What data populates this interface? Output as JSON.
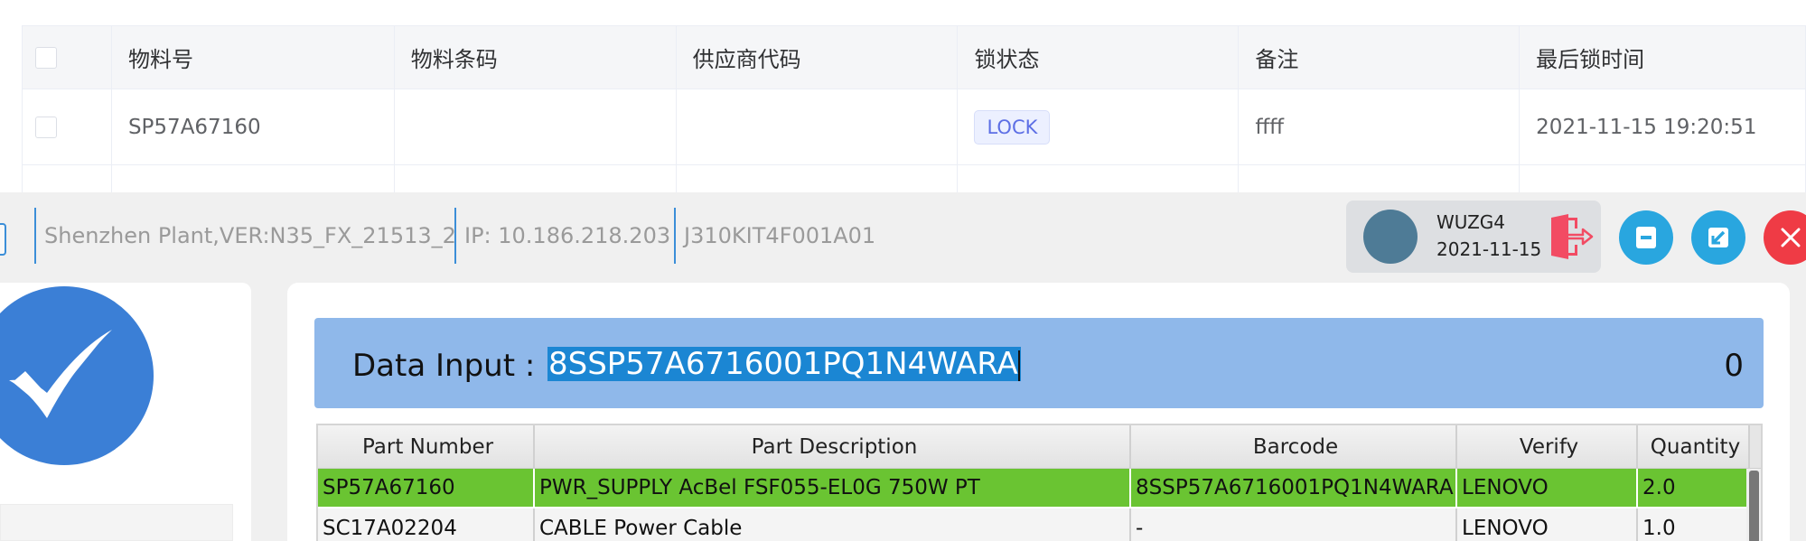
{
  "web_table": {
    "headers": [
      "物料号",
      "物料条码",
      "供应商代码",
      "锁状态",
      "备注",
      "最后锁时间"
    ],
    "rows": [
      {
        "part_no": "SP57A67160",
        "barcode": "",
        "supplier": "",
        "lock_status": "LOCK",
        "remark": "ffff",
        "last_lock_time": "2021-11-15 19:20:51"
      }
    ]
  },
  "status_bar": {
    "plant_version": "Shenzhen Plant,VER:N35_FX_21513_2",
    "ip": "IP: 10.186.218.203",
    "station": "J310KIT4F001A01"
  },
  "user": {
    "name": "WUZG4",
    "date": "2021-11-15"
  },
  "window_buttons": {
    "minimize_icon": "minimize-icon",
    "restore_icon": "restore-icon",
    "close_icon": "close-icon",
    "logout_icon": "logout-icon"
  },
  "data_input": {
    "label": "Data Input :",
    "value": "8SSP57A6716001PQ1N4WARA",
    "count": "0"
  },
  "grid": {
    "headers": [
      "Part Number",
      "Part Description",
      "Barcode",
      "Verify",
      "Quantity"
    ],
    "rows": [
      {
        "part_number": "SP57A67160",
        "description": "PWR_SUPPLY AcBel FSF055-EL0G 750W PT",
        "barcode": "8SSP57A6716001PQ1N4WARA",
        "verify": "LENOVO",
        "quantity": "2.0"
      },
      {
        "part_number": "SC17A02204",
        "description": "CABLE Power Cable",
        "barcode": "-",
        "verify": "LENOVO",
        "quantity": "1.0"
      }
    ]
  },
  "colors": {
    "accent_blue": "#29a6df",
    "close_red": "#ef3b45",
    "input_bar": "#8fb8ea",
    "selection": "#1b86d3",
    "row_ok_green": "#6ac432",
    "check_circle": "#3b7fd6"
  }
}
